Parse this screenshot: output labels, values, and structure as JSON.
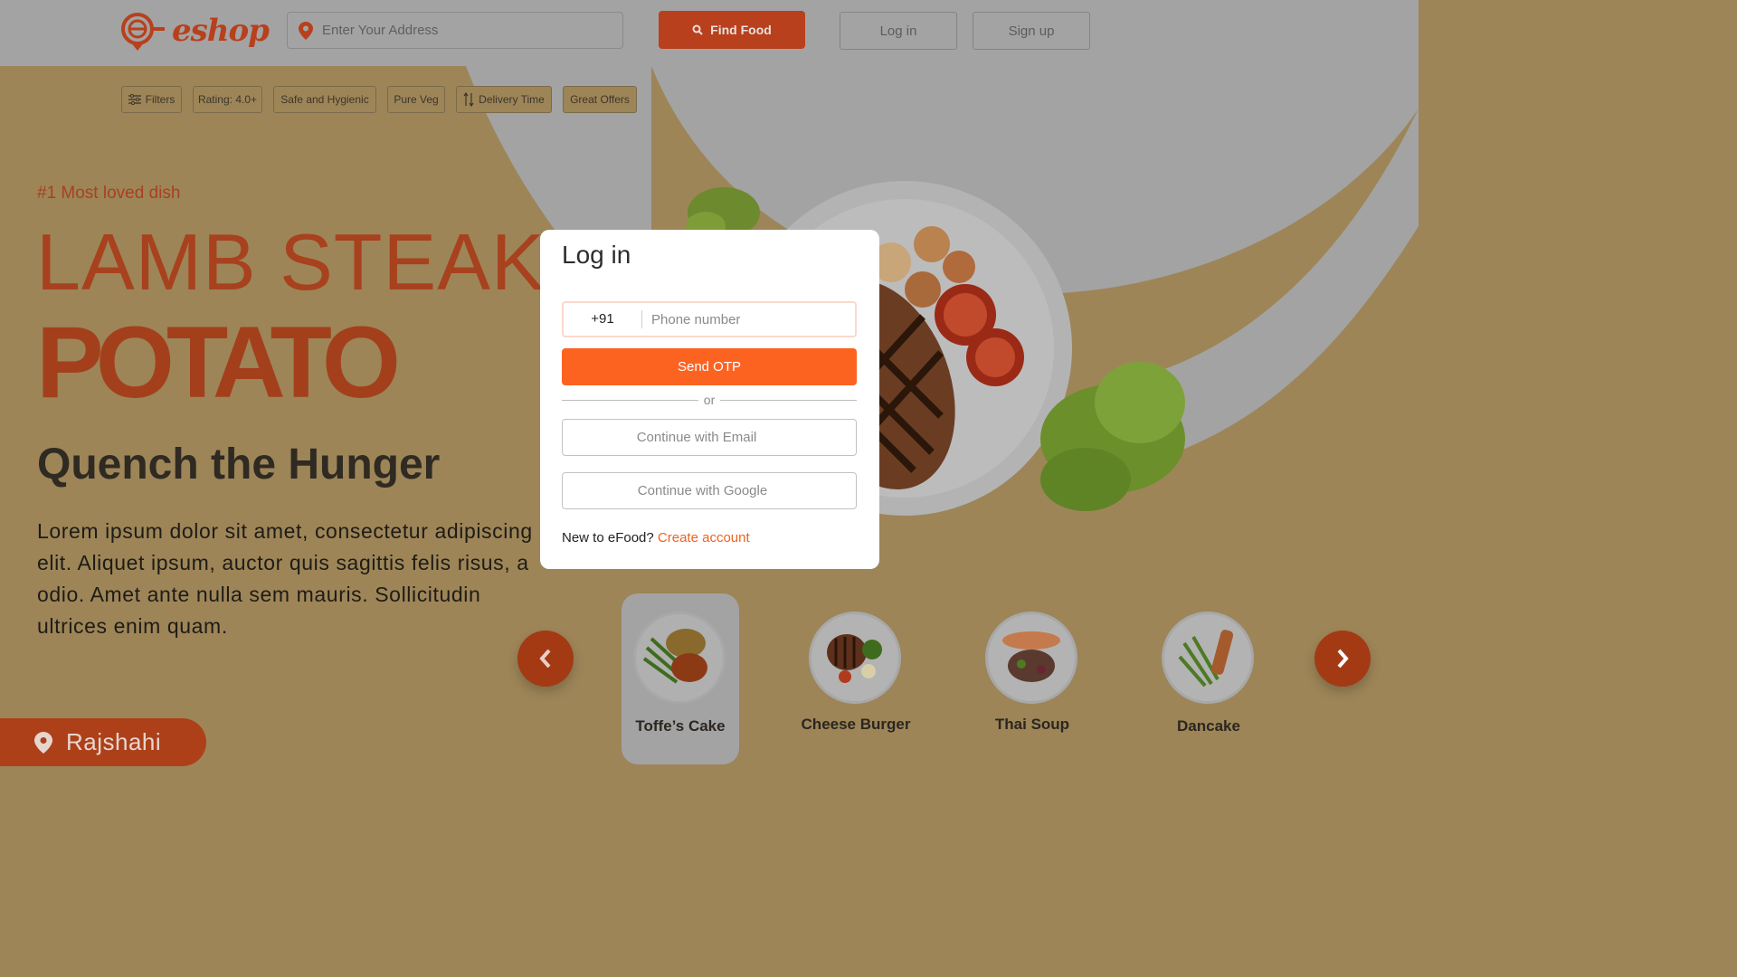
{
  "header": {
    "logo_text": "eshop",
    "address_placeholder": "Enter Your Address",
    "find_food_label": "Find Food",
    "login_label": "Log in",
    "signup_label": "Sign up"
  },
  "filters": [
    {
      "label": "Filters",
      "icon": "sliders-icon"
    },
    {
      "label": "Rating: 4.0+"
    },
    {
      "label": "Safe and Hygienic"
    },
    {
      "label": "Pure Veg"
    },
    {
      "label": "Delivery Time",
      "icon": "sort-icon"
    },
    {
      "label": "Great Offers"
    }
  ],
  "hero": {
    "tagline": "#1 Most loved dish",
    "title_line1": "LAMB STEAK",
    "title_line2": "POTATO",
    "subtitle": "Quench the Hunger",
    "description": "Lorem ipsum dolor sit amet, consectetur adipiscing elit. Aliquet ipsum, auctor quis sagittis felis risus, a odio. Amet ante nulla sem mauris. Sollicitudin ultrices enim quam.",
    "location": "Rajshahi"
  },
  "carousel": {
    "items": [
      {
        "label": "Toffe’s Cake",
        "active": true
      },
      {
        "label": "Cheese Burger",
        "active": false
      },
      {
        "label": "Thai  Soup",
        "active": false
      },
      {
        "label": "Dancake",
        "active": false
      }
    ]
  },
  "login_modal": {
    "title": "Log in",
    "country_code": "+91",
    "phone_placeholder": "Phone number",
    "send_otp_label": "Send OTP",
    "divider_text": "or",
    "email_button_label": "Continue with Email",
    "google_button_label": "Continue with Google",
    "new_user_text": "New to eFood?",
    "create_account_label": "Create account"
  },
  "colors": {
    "brand": "#b8401c",
    "accent_orange": "#fc6321",
    "overlay_bg": "#9d8558",
    "header_bg": "#a3a3a3"
  }
}
